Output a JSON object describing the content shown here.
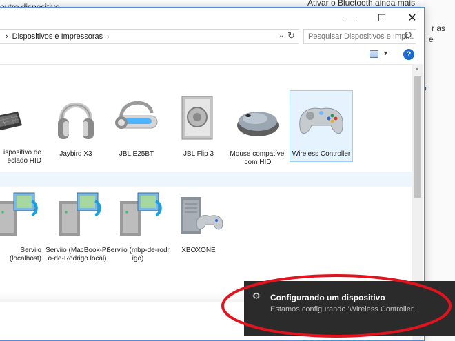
{
  "background": {
    "top_left_text": "outro dispositivo",
    "top_right_text": "Ativar o Bluetooth ainda mais",
    "right_text_a": "r as",
    "right_text_b": "e",
    "right_link": "o"
  },
  "window": {
    "controls": {
      "minimize": "—",
      "maximize": "☐",
      "close": "✕"
    },
    "breadcrumb": {
      "sep_start": "›",
      "label": "Dispositivos e Impressoras",
      "sep_end": "›"
    },
    "search": {
      "placeholder": "Pesquisar Dispositivos e Impr..."
    }
  },
  "devices": [
    {
      "id": "keyboard",
      "label": "Dispositivo de Teclado HID",
      "label_shown": "ispositivo de\neclado HID"
    },
    {
      "id": "jaybird",
      "label": "Jaybird X3"
    },
    {
      "id": "jbl-e25bt",
      "label": "JBL E25BT"
    },
    {
      "id": "jbl-flip3",
      "label": "JBL Flip 3"
    },
    {
      "id": "mouse",
      "label": "Mouse compatível com HID"
    },
    {
      "id": "wireless-controller",
      "label": "Wireless Controller",
      "selected": true
    }
  ],
  "media_devices": [
    {
      "id": "serviio-local",
      "label": "Serviio (localhost)",
      "label_shown": "Serviio\n(localhost)"
    },
    {
      "id": "serviio-macbook",
      "label": "Serviio (MacBook-Pro-de-Rodrigo.local)"
    },
    {
      "id": "serviio-mbp",
      "label": "Serviio (mbp-de-rodrigo)"
    },
    {
      "id": "xboxone",
      "label": "XBOXONE"
    }
  ],
  "toast": {
    "title": "Configurando um dispositivo",
    "body": "Estamos configurando 'Wireless Controller'.",
    "accent": "#e0141e"
  }
}
